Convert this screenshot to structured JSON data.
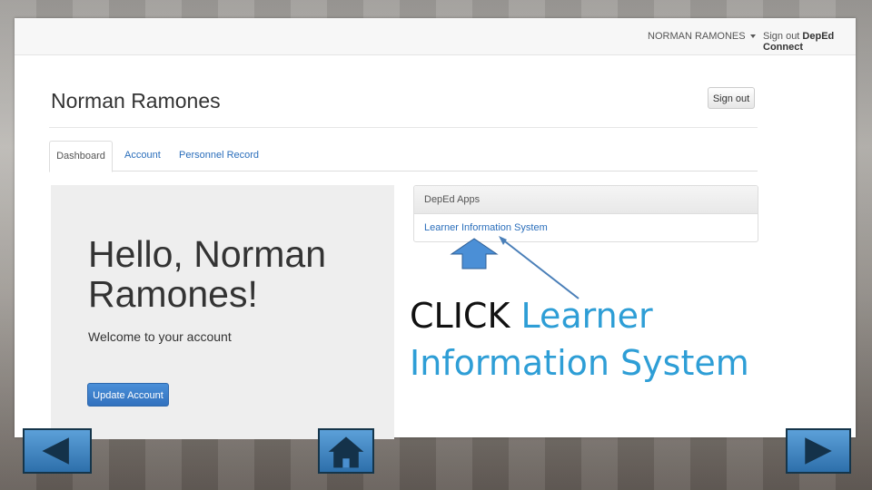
{
  "app": {
    "user_menu_label": "NORMAN RAMONES",
    "signout_prefix": "Sign out ",
    "signout_brand": "DepEd Connect"
  },
  "profile": {
    "title": "Norman Ramones",
    "signout_button": "Sign out"
  },
  "tabs": [
    {
      "label": "Dashboard",
      "active": true
    },
    {
      "label": "Account",
      "active": false
    },
    {
      "label": "Personnel Record",
      "active": false
    }
  ],
  "jumbotron": {
    "greeting": "Hello, Norman Ramones!",
    "welcome": "Welcome to your account",
    "update_button": "Update Account"
  },
  "apps_panel": {
    "header": "DepEd Apps",
    "items": [
      {
        "label": "Learner Information System"
      }
    ]
  },
  "instruction": {
    "verb": "CLICK",
    "target": "Learner Information System"
  },
  "navigation": {
    "prev_icon": "left-triangle-icon",
    "home_icon": "home-icon",
    "next_icon": "right-triangle-icon"
  },
  "colors": {
    "link": "#2a6ebb",
    "primary_button": "#3271be",
    "instruction_accent": "#2e9ed6",
    "nav_button": "#4a8fd0"
  }
}
